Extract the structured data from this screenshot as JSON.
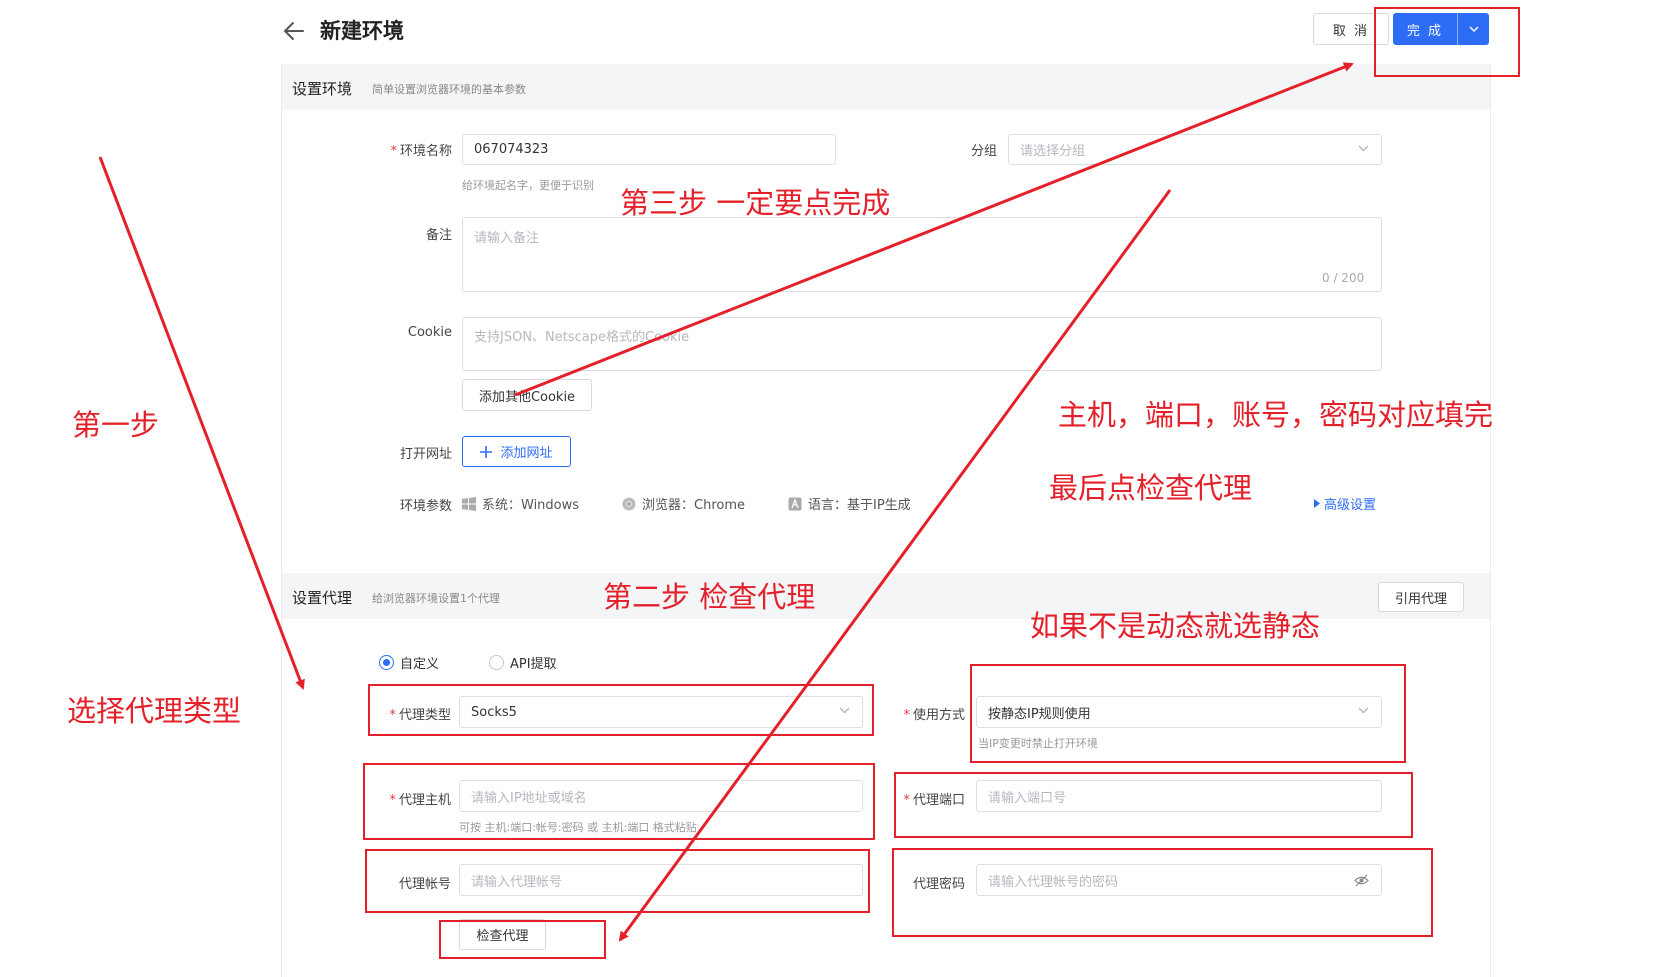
{
  "header": {
    "title": "新建环境",
    "cancel_label": "取 消",
    "done_label": "完 成"
  },
  "env_section": {
    "title": "设置环境",
    "subtitle": "简单设置浏览器环境的基本参数",
    "name_label": "环境名称",
    "name_value": "067074323",
    "name_hint": "给环境起名字，更便于识别",
    "group_label": "分组",
    "group_placeholder": "请选择分组",
    "note_label": "备注",
    "note_placeholder": "请输入备注",
    "note_counter": "0 / 200",
    "cookie_label": "Cookie",
    "cookie_placeholder": "支持JSON、Netscape格式的Cookie",
    "add_cookie_label": "添加其他Cookie",
    "open_url_label": "打开网址",
    "add_url_label": "添加网址",
    "params_label": "环境参数",
    "params": [
      {
        "icon": "windows-icon",
        "text": "系统：Windows"
      },
      {
        "icon": "chrome-icon",
        "text": "浏览器：Chrome"
      },
      {
        "icon": "language-icon",
        "text": "语言：基于IP生成"
      }
    ],
    "advanced_label": "高级设置"
  },
  "proxy_section": {
    "title": "设置代理",
    "subtitle": "给浏览器环境设置1个代理",
    "ref_proxy_label": "引用代理",
    "radio_custom": "自定义",
    "radio_api": "API提取",
    "type_label": "代理类型",
    "type_value": "Socks5",
    "usage_label": "使用方式",
    "usage_value": "按静态IP规则使用",
    "usage_hint": "当IP变更时禁止打开环境",
    "host_label": "代理主机",
    "host_placeholder": "请输入IP地址或域名",
    "host_hint": "可按 主机:端口:帐号:密码 或 主机:端口 格式粘贴",
    "port_label": "代理端口",
    "port_placeholder": "请输入端口号",
    "account_label": "代理帐号",
    "account_placeholder": "请输入代理帐号",
    "password_label": "代理密码",
    "password_placeholder": "请输入代理帐号的密码",
    "check_label": "检查代理"
  },
  "annotations": {
    "step1": "第一步",
    "choose_type": "选择代理类型",
    "step2": "第二步 检查代理",
    "step3": "第三步  一定要点完成",
    "fill": "主机，端口，账号，密码对应填完",
    "last": "最后点检查代理",
    "static": "如果不是动态就选静态"
  },
  "colors": {
    "primary": "#2d6df6",
    "annotation": "#e4212a",
    "section_bg": "#f4f5f7"
  }
}
